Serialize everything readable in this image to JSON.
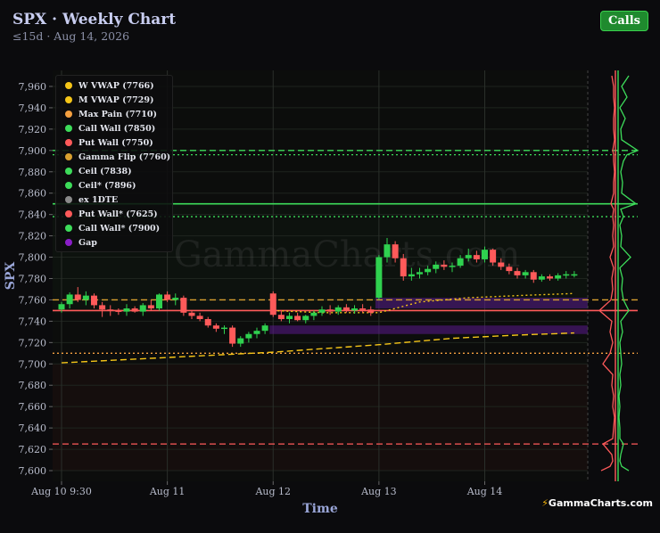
{
  "header": {
    "title": "SPX · Weekly Chart",
    "subtitle": "≤15d · Aug 14, 2026",
    "calls_button": "Calls"
  },
  "brand": {
    "mark": "⚡",
    "text": "GammaCharts.com"
  },
  "watermark": "GammaCharts.com",
  "legend": [
    {
      "label": "W VWAP (7766)",
      "color": "#f5c518"
    },
    {
      "label": "M VWAP (7729)",
      "color": "#f5c518"
    },
    {
      "label": "Max Pain (7710)",
      "color": "#f5a040"
    },
    {
      "label": "Call Wall (7850)",
      "color": "#3ddc5a"
    },
    {
      "label": "Put Wall (7750)",
      "color": "#ff5a5a"
    },
    {
      "label": "Gamma Flip (7760)",
      "color": "#d9a030"
    },
    {
      "label": "Ceil (7838)",
      "color": "#3ddc5a"
    },
    {
      "label": "Ceil* (7896)",
      "color": "#3ddc5a"
    },
    {
      "label": "ex 1DTE",
      "color": "#8a8a8a"
    },
    {
      "label": "Put Wall* (7625)",
      "color": "#ff5a5a"
    },
    {
      "label": "Call Wall* (7900)",
      "color": "#3ddc5a"
    },
    {
      "label": "Gap",
      "color": "#8a1ec8"
    }
  ],
  "colors": {
    "up": "#2fd14f",
    "down": "#ff5a5a",
    "vwap": "#f5c518",
    "gap": "#5a1a8c",
    "call": "#3ddc5a",
    "put": "#ff5a5a"
  },
  "chart_data": {
    "type": "candlestick",
    "xlabel": "Time",
    "ylabel": "SPX",
    "ylim": [
      7590,
      7975
    ],
    "xlim": [
      0,
      64
    ],
    "yticks": [
      7600,
      7620,
      7640,
      7660,
      7680,
      7700,
      7720,
      7740,
      7760,
      7780,
      7800,
      7820,
      7840,
      7860,
      7880,
      7900,
      7920,
      7940,
      7960
    ],
    "ytick_labels": [
      "7,600",
      "7,620",
      "7,640",
      "7,660",
      "7,680",
      "7,700",
      "7,720",
      "7,740",
      "7,760",
      "7,780",
      "7,800",
      "7,820",
      "7,840",
      "7,860",
      "7,880",
      "7,900",
      "7,920",
      "7,940",
      "7,960"
    ],
    "xticks": [
      {
        "pos": 0,
        "label": "Aug 10 9:30"
      },
      {
        "pos": 13,
        "label": "Aug 11"
      },
      {
        "pos": 26,
        "label": "Aug 12"
      },
      {
        "pos": 39,
        "label": "Aug 13"
      },
      {
        "pos": 52,
        "label": "Aug 14"
      }
    ],
    "candles": [
      [
        7751,
        7758,
        7748,
        7756
      ],
      [
        7756,
        7767,
        7752,
        7765
      ],
      [
        7765,
        7772,
        7758,
        7760
      ],
      [
        7760,
        7768,
        7755,
        7764
      ],
      [
        7764,
        7766,
        7752,
        7755
      ],
      [
        7755,
        7758,
        7744,
        7751
      ],
      [
        7751,
        7755,
        7745,
        7750
      ],
      [
        7750,
        7752,
        7746,
        7749
      ],
      [
        7749,
        7756,
        7745,
        7752
      ],
      [
        7752,
        7754,
        7748,
        7749
      ],
      [
        7749,
        7757,
        7745,
        7755
      ],
      [
        7755,
        7760,
        7750,
        7752
      ],
      [
        7752,
        7766,
        7750,
        7765
      ],
      [
        7765,
        7768,
        7758,
        7760
      ],
      [
        7760,
        7766,
        7755,
        7762
      ],
      [
        7762,
        7764,
        7745,
        7748
      ],
      [
        7748,
        7750,
        7742,
        7745
      ],
      [
        7745,
        7748,
        7740,
        7742
      ],
      [
        7742,
        7744,
        7734,
        7736
      ],
      [
        7736,
        7738,
        7730,
        7733
      ],
      [
        7733,
        7736,
        7728,
        7734
      ],
      [
        7734,
        7736,
        7716,
        7719
      ],
      [
        7719,
        7726,
        7716,
        7724
      ],
      [
        7724,
        7730,
        7720,
        7728
      ],
      [
        7728,
        7734,
        7724,
        7731
      ],
      [
        7731,
        7738,
        7728,
        7736
      ],
      [
        7766,
        7768,
        7744,
        7746
      ],
      [
        7746,
        7750,
        7740,
        7742
      ],
      [
        7742,
        7748,
        7738,
        7745
      ],
      [
        7745,
        7748,
        7740,
        7741
      ],
      [
        7741,
        7746,
        7738,
        7745
      ],
      [
        7745,
        7750,
        7741,
        7748
      ],
      [
        7748,
        7754,
        7745,
        7751
      ],
      [
        7751,
        7755,
        7746,
        7749
      ],
      [
        7749,
        7755,
        7746,
        7753
      ],
      [
        7753,
        7756,
        7748,
        7750
      ],
      [
        7750,
        7755,
        7747,
        7752
      ],
      [
        7752,
        7756,
        7748,
        7751
      ],
      [
        7751,
        7754,
        7745,
        7748
      ],
      [
        7762,
        7802,
        7760,
        7800
      ],
      [
        7800,
        7818,
        7795,
        7812
      ],
      [
        7812,
        7815,
        7795,
        7799
      ],
      [
        7799,
        7803,
        7778,
        7782
      ],
      [
        7782,
        7790,
        7778,
        7784
      ],
      [
        7784,
        7790,
        7780,
        7786
      ],
      [
        7786,
        7792,
        7783,
        7789
      ],
      [
        7789,
        7796,
        7785,
        7793
      ],
      [
        7793,
        7797,
        7788,
        7791
      ],
      [
        7791,
        7795,
        7786,
        7792
      ],
      [
        7792,
        7802,
        7790,
        7799
      ],
      [
        7799,
        7808,
        7796,
        7802
      ],
      [
        7802,
        7806,
        7795,
        7798
      ],
      [
        7798,
        7810,
        7795,
        7807
      ],
      [
        7807,
        7808,
        7792,
        7795
      ],
      [
        7795,
        7799,
        7788,
        7791
      ],
      [
        7791,
        7794,
        7784,
        7787
      ],
      [
        7787,
        7790,
        7780,
        7783
      ],
      [
        7783,
        7788,
        7780,
        7786
      ],
      [
        7786,
        7788,
        7776,
        7779
      ],
      [
        7779,
        7784,
        7777,
        7782
      ],
      [
        7782,
        7784,
        7778,
        7780
      ],
      [
        7780,
        7785,
        7778,
        7783
      ],
      [
        7783,
        7787,
        7780,
        7784
      ],
      [
        7784,
        7787,
        7781,
        7784
      ]
    ],
    "levels": [
      {
        "name": "Call Wall* (7900)",
        "value": 7900,
        "color": "#3ddc5a",
        "style": "dashed"
      },
      {
        "name": "Ceil* (7896)",
        "value": 7896,
        "color": "#3ddc5a",
        "style": "dotted"
      },
      {
        "name": "Call Wall (7850)",
        "value": 7850,
        "color": "#3ddc5a",
        "style": "solid"
      },
      {
        "name": "Ceil (7838)",
        "value": 7838,
        "color": "#3ddc5a",
        "style": "dotted"
      },
      {
        "name": "Gamma Flip (7760)",
        "value": 7760,
        "color": "#d9a030",
        "style": "dashed"
      },
      {
        "name": "Put Wall (7750)",
        "value": 7750,
        "color": "#ff5a5a",
        "style": "solid"
      },
      {
        "name": "Max Pain (7710)",
        "value": 7710,
        "color": "#f5a040",
        "style": "dotted"
      },
      {
        "name": "Put Wall* (7625)",
        "value": 7625,
        "color": "#ff5a5a",
        "style": "dashed"
      }
    ],
    "gaps": [
      {
        "x0": 26,
        "x1": 64,
        "y0": 7728,
        "y1": 7736
      },
      {
        "x0": 39,
        "x1": 64,
        "y0": 7752,
        "y1": 7762
      }
    ],
    "vwap_lines": [
      {
        "name": "W VWAP",
        "style": "dotted",
        "points": [
          [
            26,
            7750
          ],
          [
            32,
            7748
          ],
          [
            39,
            7748
          ],
          [
            44,
            7758
          ],
          [
            50,
            7762
          ],
          [
            56,
            7764
          ],
          [
            63,
            7766
          ]
        ]
      },
      {
        "name": "M VWAP",
        "style": "dashed",
        "points": [
          [
            0,
            7701
          ],
          [
            13,
            7706
          ],
          [
            26,
            7711
          ],
          [
            39,
            7718
          ],
          [
            48,
            7724
          ],
          [
            56,
            7727
          ],
          [
            63,
            7729
          ]
        ]
      }
    ]
  }
}
